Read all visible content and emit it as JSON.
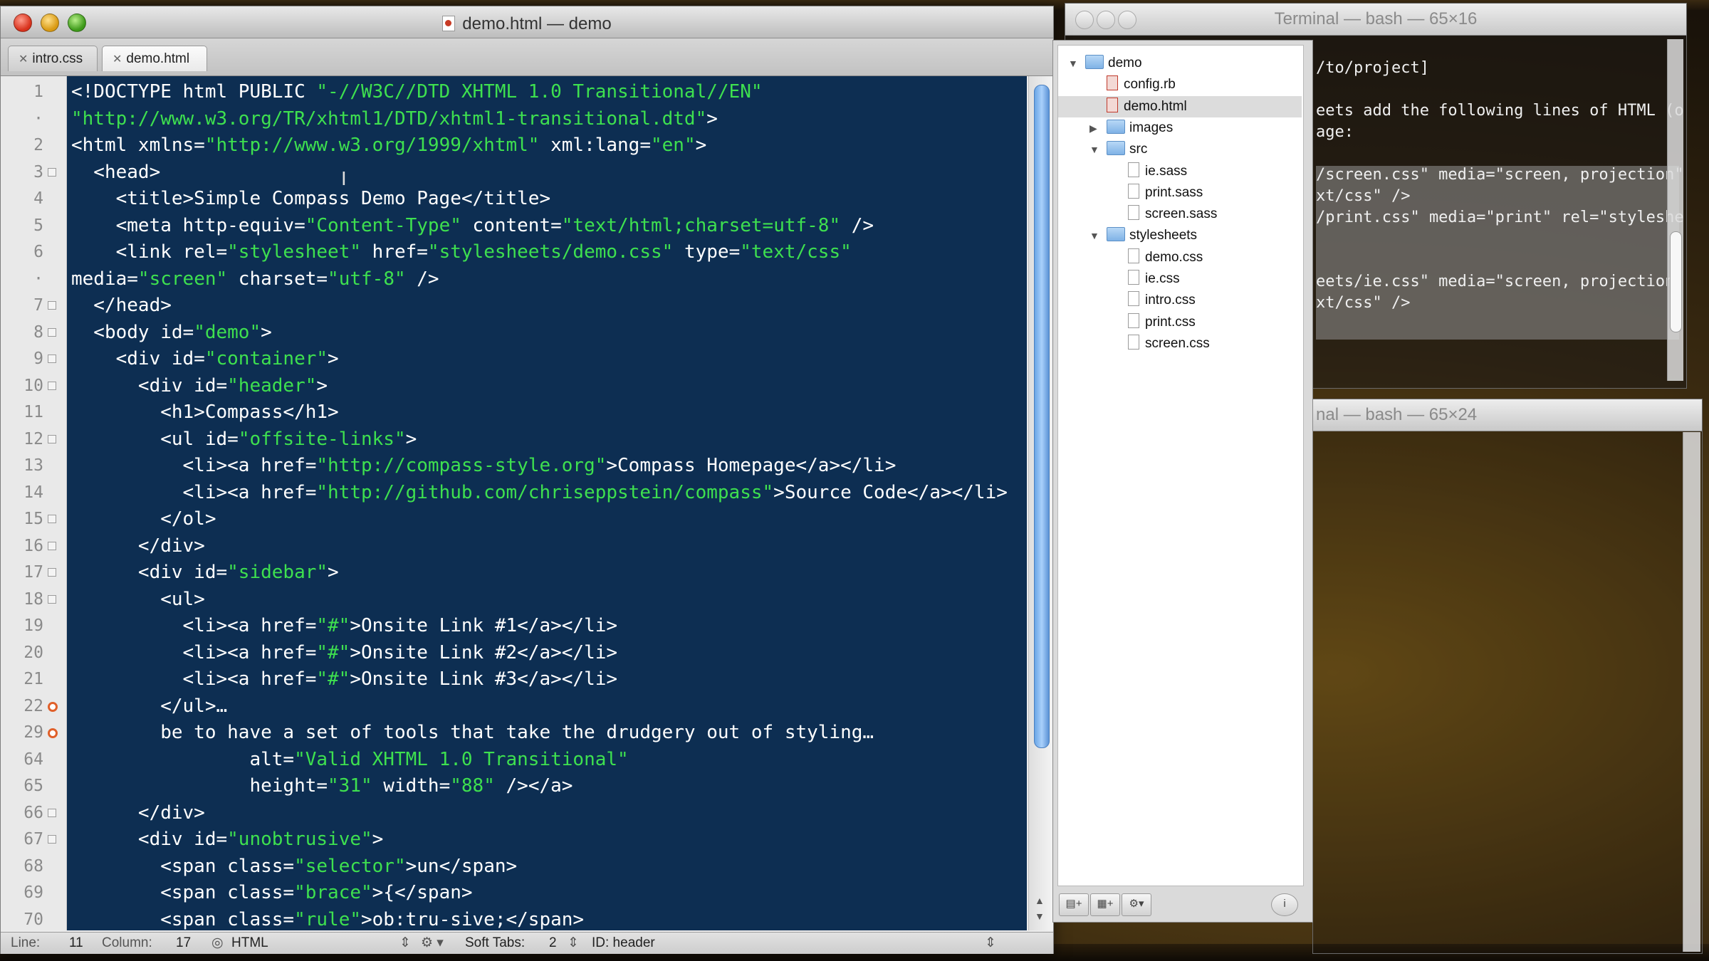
{
  "editor": {
    "title": "demo.html — demo",
    "tabs": [
      {
        "label": "intro.css",
        "active": false
      },
      {
        "label": "demo.html",
        "active": true
      }
    ],
    "code_lines": [
      {
        "num": "1",
        "fold": "",
        "segs": [
          {
            "c": "t",
            "t": "<!DOCTYPE html PUBLIC "
          },
          {
            "c": "s",
            "t": "\"-//W3C//DTD XHTML 1.0 Transitional//EN\""
          }
        ]
      },
      {
        "num": "·",
        "fold": "",
        "segs": [
          {
            "c": "s",
            "t": "\"http://www.w3.org/TR/xhtml1/DTD/xhtml1-transitional.dtd\""
          },
          {
            "c": "t",
            "t": ">"
          }
        ]
      },
      {
        "num": "2",
        "fold": "",
        "segs": [
          {
            "c": "t",
            "t": "<html xmlns="
          },
          {
            "c": "s",
            "t": "\"http://www.w3.org/1999/xhtml\""
          },
          {
            "c": "t",
            "t": " xml:lang="
          },
          {
            "c": "s",
            "t": "\"en\""
          },
          {
            "c": "t",
            "t": ">"
          }
        ]
      },
      {
        "num": "3",
        "fold": "open",
        "segs": [
          {
            "c": "t",
            "t": "  <head>"
          }
        ]
      },
      {
        "num": "4",
        "fold": "",
        "segs": [
          {
            "c": "t",
            "t": "    <title>Simple Compass Demo Page</title>"
          }
        ]
      },
      {
        "num": "5",
        "fold": "",
        "segs": [
          {
            "c": "t",
            "t": "    <meta http-equiv="
          },
          {
            "c": "s",
            "t": "\"Content-Type\""
          },
          {
            "c": "t",
            "t": " content="
          },
          {
            "c": "s",
            "t": "\"text/html;charset=utf-8\""
          },
          {
            "c": "t",
            "t": " />"
          }
        ]
      },
      {
        "num": "6",
        "fold": "",
        "segs": [
          {
            "c": "t",
            "t": "    <link rel="
          },
          {
            "c": "s",
            "t": "\"stylesheet\""
          },
          {
            "c": "t",
            "t": " href="
          },
          {
            "c": "s",
            "t": "\"stylesheets/demo.css\""
          },
          {
            "c": "t",
            "t": " type="
          },
          {
            "c": "s",
            "t": "\"text/css\""
          }
        ]
      },
      {
        "num": "·",
        "fold": "",
        "segs": [
          {
            "c": "t",
            "t": "media="
          },
          {
            "c": "s",
            "t": "\"screen\""
          },
          {
            "c": "t",
            "t": " charset="
          },
          {
            "c": "s",
            "t": "\"utf-8\""
          },
          {
            "c": "t",
            "t": " />"
          }
        ]
      },
      {
        "num": "7",
        "fold": "open",
        "segs": [
          {
            "c": "t",
            "t": "  </head>"
          }
        ]
      },
      {
        "num": "8",
        "fold": "open",
        "segs": [
          {
            "c": "t",
            "t": "  <body id="
          },
          {
            "c": "s",
            "t": "\"demo\""
          },
          {
            "c": "t",
            "t": ">"
          }
        ]
      },
      {
        "num": "9",
        "fold": "open",
        "segs": [
          {
            "c": "t",
            "t": "    <div id="
          },
          {
            "c": "s",
            "t": "\"container\""
          },
          {
            "c": "t",
            "t": ">"
          }
        ]
      },
      {
        "num": "10",
        "fold": "open",
        "segs": [
          {
            "c": "t",
            "t": "      <div id="
          },
          {
            "c": "s",
            "t": "\"header\""
          },
          {
            "c": "t",
            "t": ">"
          }
        ]
      },
      {
        "num": "11",
        "fold": "",
        "segs": [
          {
            "c": "t",
            "t": "        <h1>Compass</h1>"
          }
        ]
      },
      {
        "num": "12",
        "fold": "open",
        "segs": [
          {
            "c": "t",
            "t": "        <ul id="
          },
          {
            "c": "s",
            "t": "\"offsite-links\""
          },
          {
            "c": "t",
            "t": ">"
          }
        ]
      },
      {
        "num": "13",
        "fold": "",
        "segs": [
          {
            "c": "t",
            "t": "          <li><a href="
          },
          {
            "c": "s",
            "t": "\"http://compass-style.org\""
          },
          {
            "c": "t",
            "t": ">Compass Homepage</a></li>"
          }
        ]
      },
      {
        "num": "14",
        "fold": "",
        "segs": [
          {
            "c": "t",
            "t": "          <li><a href="
          },
          {
            "c": "s",
            "t": "\"http://github.com/chriseppstein/compass\""
          },
          {
            "c": "t",
            "t": ">Source Code</a></li>"
          }
        ]
      },
      {
        "num": "15",
        "fold": "open",
        "segs": [
          {
            "c": "t",
            "t": "        </ol>"
          }
        ]
      },
      {
        "num": "16",
        "fold": "open",
        "segs": [
          {
            "c": "t",
            "t": "      </div>"
          }
        ]
      },
      {
        "num": "17",
        "fold": "open",
        "segs": [
          {
            "c": "t",
            "t": "      <div id="
          },
          {
            "c": "s",
            "t": "\"sidebar\""
          },
          {
            "c": "t",
            "t": ">"
          }
        ]
      },
      {
        "num": "18",
        "fold": "open",
        "segs": [
          {
            "c": "t",
            "t": "        <ul>"
          }
        ]
      },
      {
        "num": "19",
        "fold": "",
        "segs": [
          {
            "c": "t",
            "t": "          <li><a href="
          },
          {
            "c": "s",
            "t": "\"#\""
          },
          {
            "c": "t",
            "t": ">Onsite Link #1</a></li>"
          }
        ]
      },
      {
        "num": "20",
        "fold": "",
        "segs": [
          {
            "c": "t",
            "t": "          <li><a href="
          },
          {
            "c": "s",
            "t": "\"#\""
          },
          {
            "c": "t",
            "t": ">Onsite Link #2</a></li>"
          }
        ]
      },
      {
        "num": "21",
        "fold": "",
        "segs": [
          {
            "c": "t",
            "t": "          <li><a href="
          },
          {
            "c": "s",
            "t": "\"#\""
          },
          {
            "c": "t",
            "t": ">Onsite Link #3</a></li>"
          }
        ]
      },
      {
        "num": "22",
        "fold": "closed",
        "segs": [
          {
            "c": "t",
            "t": "        </ul>…"
          }
        ]
      },
      {
        "num": "29",
        "fold": "closed",
        "segs": [
          {
            "c": "t",
            "t": "        be to have a set of tools that take the drudgery out of styling…"
          }
        ]
      },
      {
        "num": "64",
        "fold": "",
        "segs": [
          {
            "c": "t",
            "t": "                alt="
          },
          {
            "c": "s",
            "t": "\"Valid XHTML 1.0 Transitional\""
          }
        ]
      },
      {
        "num": "65",
        "fold": "",
        "segs": [
          {
            "c": "t",
            "t": "                height="
          },
          {
            "c": "s",
            "t": "\"31\""
          },
          {
            "c": "t",
            "t": " width="
          },
          {
            "c": "s",
            "t": "\"88\""
          },
          {
            "c": "t",
            "t": " /></a>"
          }
        ]
      },
      {
        "num": "66",
        "fold": "open",
        "segs": [
          {
            "c": "t",
            "t": "      </div>"
          }
        ]
      },
      {
        "num": "67",
        "fold": "open",
        "segs": [
          {
            "c": "t",
            "t": "      <div id="
          },
          {
            "c": "s",
            "t": "\"unobtrusive\""
          },
          {
            "c": "t",
            "t": ">"
          }
        ]
      },
      {
        "num": "68",
        "fold": "",
        "segs": [
          {
            "c": "t",
            "t": "        <span class="
          },
          {
            "c": "s",
            "t": "\"selector\""
          },
          {
            "c": "t",
            "t": ">un</span>"
          }
        ]
      },
      {
        "num": "69",
        "fold": "",
        "segs": [
          {
            "c": "t",
            "t": "        <span class="
          },
          {
            "c": "s",
            "t": "\"brace\""
          },
          {
            "c": "t",
            "t": ">{</span>"
          }
        ]
      },
      {
        "num": "70",
        "fold": "",
        "segs": [
          {
            "c": "t",
            "t": "        <span class="
          },
          {
            "c": "s",
            "t": "\"rule\""
          },
          {
            "c": "t",
            "t": ">ob:tru-sive;</span>"
          }
        ]
      }
    ],
    "status": {
      "line_label": "Line:",
      "line_value": "11",
      "column_label": "Column:",
      "column_value": "17",
      "language": "HTML",
      "tabs_label": "Soft Tabs:",
      "tabs_value": "2",
      "symbol": "ID: header"
    }
  },
  "drawer": {
    "items": [
      {
        "label": "demo",
        "kind": "folder",
        "level": 0,
        "expanded": true
      },
      {
        "label": "config.rb",
        "kind": "file-red",
        "level": 1
      },
      {
        "label": "demo.html",
        "kind": "file-red",
        "level": 1,
        "selected": true
      },
      {
        "label": "images",
        "kind": "folder",
        "level": 1,
        "expanded": false
      },
      {
        "label": "src",
        "kind": "folder",
        "level": 1,
        "expanded": true
      },
      {
        "label": "ie.sass",
        "kind": "file",
        "level": 2
      },
      {
        "label": "print.sass",
        "kind": "file",
        "level": 2
      },
      {
        "label": "screen.sass",
        "kind": "file",
        "level": 2
      },
      {
        "label": "stylesheets",
        "kind": "folder",
        "level": 1,
        "expanded": true
      },
      {
        "label": "demo.css",
        "kind": "file",
        "level": 2
      },
      {
        "label": "ie.css",
        "kind": "file",
        "level": 2
      },
      {
        "label": "intro.css",
        "kind": "file",
        "level": 2
      },
      {
        "label": "print.css",
        "kind": "file",
        "level": 2
      },
      {
        "label": "screen.css",
        "kind": "file",
        "level": 2
      }
    ],
    "tools": [
      "new-file-icon",
      "new-folder-icon",
      "gear-icon",
      "info-icon"
    ]
  },
  "terminal1": {
    "title": "Terminal — bash — 65×16",
    "lines": [
      "/to/project]",
      "",
      "eets add the following lines of HTML (o",
      "age:",
      "",
      "/screen.css\" media=\"screen, projection\"",
      "xt/css\" />",
      "/print.css\" media=\"print\" rel=\"styleshe",
      "",
      "",
      "eets/ie.css\" media=\"screen, projection\"",
      "xt/css\" />"
    ]
  },
  "terminal2": {
    "title": "nal — bash — 65×24"
  },
  "colors": {
    "editor_bg": "#0d2e52",
    "string": "#3ee04f",
    "text": "#ffffff",
    "fold_closed": "#e0602a",
    "scroll_thumb": "#6aa6e6"
  }
}
